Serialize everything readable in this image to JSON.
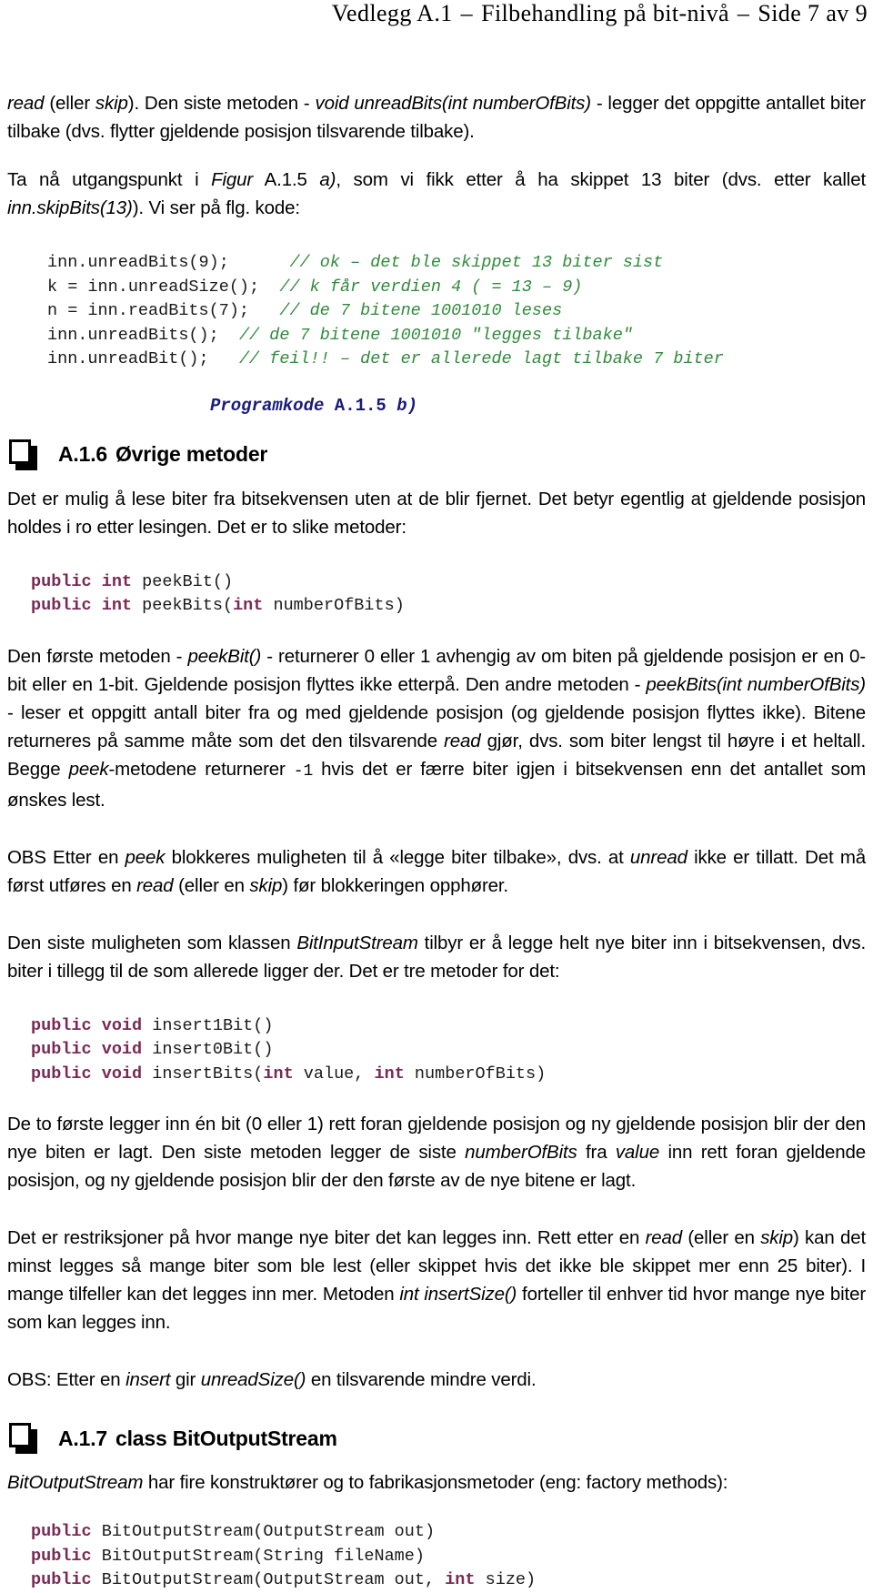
{
  "header": {
    "part1": "Vedlegg A.1",
    "dash1": "–",
    "part2": "Filbehandling på bit-nivå",
    "dash2": "–",
    "part3": "Side 7 av 9"
  },
  "paragraphs": {
    "p1_a": "read",
    "p1_b": " (eller ",
    "p1_c": "skip",
    "p1_d": "). Den siste metoden - ",
    "p1_e": "void unreadBits(int numberOfBits)",
    "p1_f": " - legger det oppgitte antallet biter tilbake (dvs. flytter gjeldende posisjon tilsvarende tilbake).",
    "p2_a": "Ta nå utgangspunkt i ",
    "p2_b": "Figur",
    "p2_c": " A.1.5 ",
    "p2_d": "a)",
    "p2_e": ", som vi fikk etter å ha skippet 13 biter (dvs. etter kallet ",
    "p2_f": "inn.skipBits(13)",
    "p2_g": "). Vi ser på flg. kode:",
    "p3_a": "Det er mulig å lese biter fra bitsekvensen uten at de blir fjernet. Det betyr egentlig at gjeldende posisjon holdes i ro etter lesingen. Det er to slike metoder:",
    "p4_a": "Den første metoden - ",
    "p4_b": "peekBit()",
    "p4_c": " - returnerer 0 eller 1 avhengig av om biten på gjeldende posisjon er en 0-bit eller en 1-bit. Gjeldende posisjon flyttes ikke etterpå. Den andre metoden - ",
    "p4_d": "peekBits(int numberOfBits)",
    "p4_e": " - leser et oppgitt antall biter fra og med gjeldende posisjon (og gjeldende posisjon flyttes ikke). Bitene returneres på samme måte som det den tilsvarende ",
    "p4_f": "read",
    "p4_g": " gjør, dvs. som biter lengst til høyre i et heltall. Begge ",
    "p4_h": "peek",
    "p4_i": "-metodene returnerer ",
    "p4_j": "-1",
    "p4_k": " hvis det er færre biter igjen i bitsekvensen enn det antallet som ønskes lest.",
    "p5_a": "OBS Etter en ",
    "p5_b": "peek",
    "p5_c": " blokkeres muligheten til å «legge biter tilbake», dvs. at ",
    "p5_d": "unread",
    "p5_e": " ikke er tillatt. Det må først utføres en ",
    "p5_f": "read",
    "p5_g": " (eller en ",
    "p5_h": "skip",
    "p5_i": ") før blokkeringen opphører.",
    "p6_a": "Den siste muligheten som klassen ",
    "p6_b": "BitInputStream",
    "p6_c": " tilbyr er å legge helt nye biter inn i bitsekvensen, dvs. biter i tillegg til de som allerede ligger der. Det er tre metoder for det:",
    "p7_a": "De to første legger inn én bit (0 eller 1) rett foran gjeldende posisjon og ny gjeldende posisjon blir der den nye biten er lagt. Den siste metoden legger de siste ",
    "p7_b": "numberOfBits",
    "p7_c": " fra ",
    "p7_d": "value",
    "p7_e": " inn rett foran gjeldende posisjon, og ny gjeldende posisjon blir der den første av de nye bitene er lagt.",
    "p8_a": "Det er restriksjoner på hvor mange nye biter det kan legges inn. Rett etter en ",
    "p8_b": "read",
    "p8_c": " (eller en ",
    "p8_d": "skip",
    "p8_e": ") kan det minst legges så mange biter som ble lest (eller skippet hvis det ikke ble skippet mer enn 25 biter). I mange tilfeller kan det legges inn mer. Metoden ",
    "p8_f": "int insertSize()",
    "p8_g": " forteller til enhver tid hvor mange nye biter som kan legges inn.",
    "p9_a": "OBS: Etter en ",
    "p9_b": "insert",
    "p9_c": " gir ",
    "p9_d": "unreadSize()",
    "p9_e": " en tilsvarende mindre verdi.",
    "p10_a": "BitOutputStream",
    "p10_b": " har fire konstruktører og to fabrikasjonsmetoder (eng: factory methods):"
  },
  "code_block_1": {
    "lines": [
      {
        "code": "inn.unreadBits(9);      ",
        "comment": "// ok – det ble skippet 13 biter sist"
      },
      {
        "code": "k = inn.unreadSize();  ",
        "comment": "// k får verdien 4 ( = 13 – 9)"
      },
      {
        "code": "n = inn.readBits(7);   ",
        "comment": "// de 7 bitene 1001010 leses"
      },
      {
        "code": "inn.unreadBits();  ",
        "comment": "// de 7 bitene 1001010 \"legges tilbake\""
      },
      {
        "code": "inn.unreadBit();   ",
        "comment": "// feil!! – det er allerede lagt tilbake 7 biter"
      }
    ]
  },
  "caption_1": {
    "italic_1": "Programkode",
    "upright": " A.1.5 ",
    "italic_2": "b)"
  },
  "section_a16": {
    "number": "A.1.6",
    "title": "Øvrige metoder"
  },
  "code_block_2": {
    "lines": [
      {
        "kw1": "public int",
        "rest": " peekBit()"
      },
      {
        "kw1": "public int",
        "rest": " peekBits(",
        "kw2": "int",
        "rest2": " numberOfBits)"
      }
    ]
  },
  "code_block_3": {
    "lines": [
      {
        "kw1": "public void",
        "rest": " insert1Bit()"
      },
      {
        "kw1": "public void",
        "rest": " insert0Bit()"
      },
      {
        "kw1": "public void",
        "rest": " insertBits(",
        "kw2": "int",
        "rest2": " value, ",
        "kw3": "int",
        "rest3": " numberOfBits)"
      }
    ]
  },
  "section_a17": {
    "number": "A.1.7",
    "title": "class BitOutputStream"
  },
  "code_block_4": {
    "lines": [
      {
        "kw1": "public",
        "rest": " BitOutputStream(OutputStream out)"
      },
      {
        "kw1": "public",
        "rest": " BitOutputStream(String fileName)"
      },
      {
        "kw1": "public",
        "rest": " BitOutputStream(OutputStream out, ",
        "kw2": "int",
        "rest2": " size)"
      }
    ]
  },
  "colors": {
    "comment_green": "#2f8a3b",
    "keyword_purple": "#7a2a55",
    "caption_navy": "#1b1b7a",
    "text_black": "#000000"
  }
}
